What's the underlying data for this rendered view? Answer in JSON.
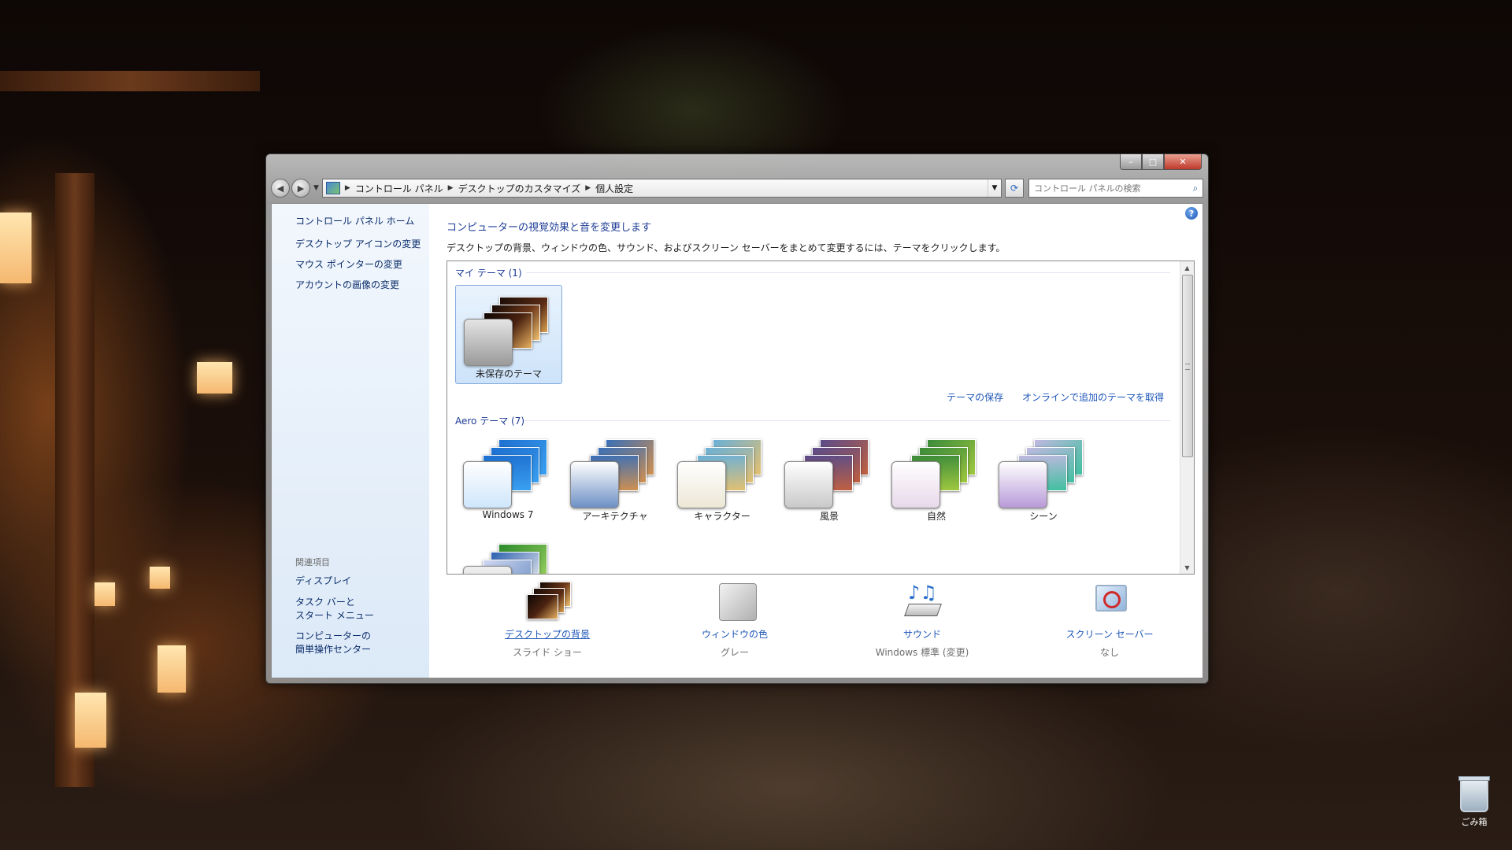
{
  "window": {
    "caption_buttons": {
      "minimize": "–",
      "maximize": "□",
      "close": "✕"
    },
    "nav": {
      "back_icon": "back-arrow-icon",
      "forward_icon": "forward-arrow-icon"
    },
    "breadcrumbs": [
      "コントロール パネル",
      "デスクトップのカスタマイズ",
      "個人設定"
    ],
    "search_placeholder": "コントロール パネルの検索"
  },
  "sidebar": {
    "home": "コントロール パネル ホーム",
    "links": [
      "デスクトップ アイコンの変更",
      "マウス ポインターの変更",
      "アカウントの画像の変更"
    ],
    "related_label": "関連項目",
    "related": [
      {
        "line1": "ディスプレイ",
        "line2": ""
      },
      {
        "line1": "タスク バーと",
        "line2": "スタート メニュー"
      },
      {
        "line1": "コンピューターの",
        "line2": "簡単操作センター"
      }
    ]
  },
  "main": {
    "title": "コンピューターの視覚効果と音を変更します",
    "description": "デスクトップの背景、ウィンドウの色、サウンド、およびスクリーン セーバーをまとめて変更するには、テーマをクリックします。",
    "my_themes_title": "マイ テーマ (1)",
    "my_themes": [
      {
        "label": "未保存のテーマ",
        "selected": true
      }
    ],
    "save_theme": "テーマの保存",
    "get_more_online": "オンラインで追加のテーマを取得",
    "aero_themes_title": "Aero テーマ (7)",
    "aero_themes": [
      {
        "label": "Windows 7",
        "swatch": "#cfe6fb",
        "c1": "#1e6fd0",
        "c2": "#3aa0f0"
      },
      {
        "label": "アーキテクチャ",
        "swatch": "#6c8fc4",
        "c1": "#3a6fb8",
        "c2": "#d09050"
      },
      {
        "label": "キャラクター",
        "swatch": "#ece7d6",
        "c1": "#6ab0d8",
        "c2": "#e4c070"
      },
      {
        "label": "風景",
        "swatch": "#c9c9c9",
        "c1": "#5a4c8a",
        "c2": "#c06040"
      },
      {
        "label": "自然",
        "swatch": "#e8d8ea",
        "c1": "#3a8a3a",
        "c2": "#a0c840"
      },
      {
        "label": "シーン",
        "swatch": "#b89ad8",
        "c1": "#c0b8e0",
        "c2": "#40c0a0"
      }
    ]
  },
  "bottom": [
    {
      "title": "デスクトップの背景",
      "subtitle": "スライド ショー",
      "icon": "desktop-background-icon"
    },
    {
      "title": "ウィンドウの色",
      "subtitle": "グレー",
      "icon": "window-color-icon"
    },
    {
      "title": "サウンド",
      "subtitle": "Windows 標準 (変更)",
      "icon": "sound-icon"
    },
    {
      "title": "スクリーン セーバー",
      "subtitle": "なし",
      "icon": "screen-saver-icon"
    }
  ],
  "desktop": {
    "recycle_bin": "ごみ箱"
  },
  "colors": {
    "link": "#1e56b8",
    "heading": "#1e3c96",
    "sidebar_bg": "#dce9f7"
  }
}
